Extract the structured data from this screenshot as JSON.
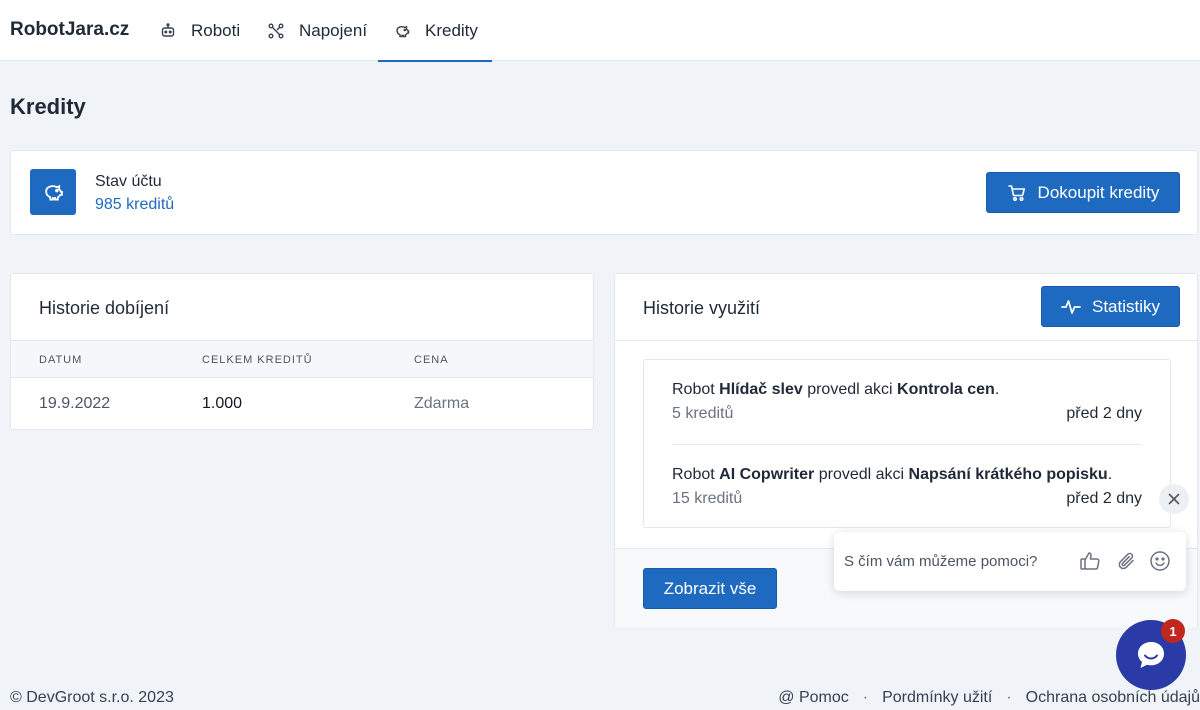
{
  "nav": {
    "brand": "RobotJara.cz",
    "items": [
      {
        "label": "Roboti",
        "icon": "robot-icon"
      },
      {
        "label": "Napojení",
        "icon": "connections-icon"
      },
      {
        "label": "Kredity",
        "icon": "piggy-bank-icon",
        "active": true
      }
    ]
  },
  "page": {
    "title": "Kredity"
  },
  "account": {
    "icon": "piggy-bank-icon",
    "label": "Stav účtu",
    "value": "985 kreditů",
    "buy_button": "Dokoupit kredity"
  },
  "recharge": {
    "title": "Historie dobíjení",
    "columns": [
      "DATUM",
      "CELKEM KREDITŮ",
      "CENA"
    ],
    "rows": [
      {
        "date": "19.9.2022",
        "credits": "1.000",
        "price": "Zdarma"
      }
    ]
  },
  "usage": {
    "title": "Historie využití",
    "stats_button": "Statistiky",
    "items": [
      {
        "prefix": "Robot ",
        "robot": "Hlídač slev",
        "middle": " provedl akci ",
        "action": "Kontrola cen",
        "suffix": ".",
        "credits": "5 kreditů",
        "when": "před 2 dny"
      },
      {
        "prefix": "Robot ",
        "robot": "AI Copwriter",
        "middle": " provedl akci ",
        "action": "Napsání krátkého popisku",
        "suffix": ".",
        "credits": "15 kreditů",
        "when": "před 2 dny"
      }
    ],
    "show_all": "Zobrazit vše"
  },
  "footer": {
    "copyright": "© DevGroot s.r.o. 2023",
    "links": [
      "@ Pomoc",
      "Pordmínky užití",
      "Ochrana osobních údajů"
    ],
    "separator": "·"
  },
  "chat": {
    "placeholder": "S čím vám můžeme pomoci?",
    "badge": "1",
    "colors": {
      "launcher": "#2a3aa6",
      "badge": "#c0281f"
    }
  },
  "colors": {
    "accent": "#1f6ac1",
    "background": "#f0f3f8"
  }
}
